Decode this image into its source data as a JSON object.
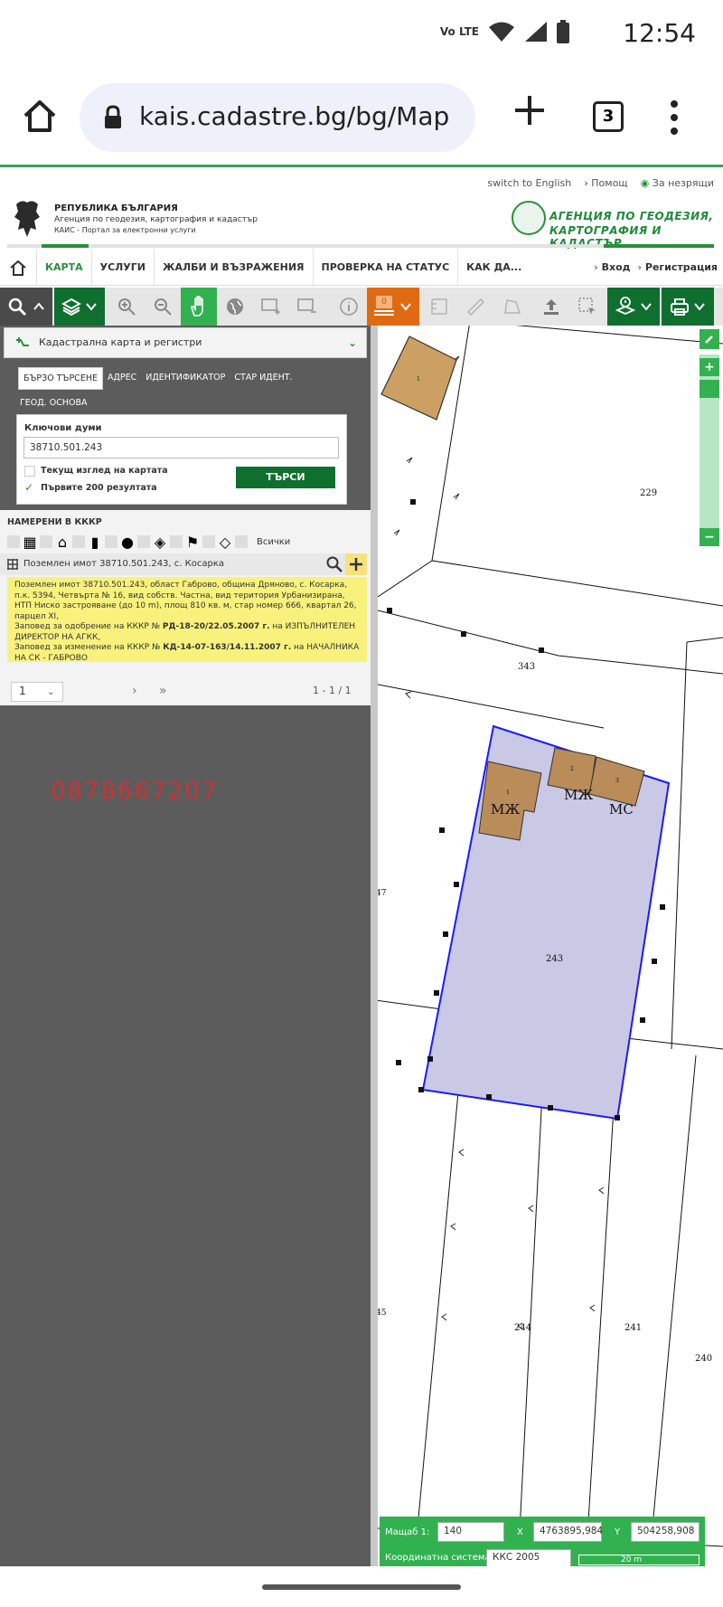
{
  "status_bar": {
    "time": "12:54",
    "network": "Vo LTE"
  },
  "browser": {
    "url": "kais.cadastre.bg/bg/Map",
    "tab_count": "3"
  },
  "header": {
    "top_links": {
      "english": "switch to English",
      "help": "Помощ",
      "accessibility": "За незрящи"
    },
    "republic_title": "РЕПУБЛИКА БЪЛГАРИЯ",
    "republic_sub1": "Агенция по геодезия, картография и кадастър",
    "republic_sub2": "КАИС - Портал за електронни услуги",
    "agency_line1": "АГЕНЦИЯ ПО ГЕОДЕЗИЯ,",
    "agency_line2": "КАРТОГРАФИЯ И КАДАСТЪР"
  },
  "nav": {
    "items": [
      "КАРТА",
      "УСЛУГИ",
      "ЖАЛБИ И ВЪЗРАЖЕНИЯ",
      "ПРОВЕРКА НА СТАТУС",
      "КАК ДА..."
    ],
    "login": "Вход",
    "register": "Регистрация"
  },
  "toolbar": {
    "orange_badge": "0"
  },
  "panel": {
    "layer_label": "Кадастрална карта и регистри",
    "tabs": [
      "БЪРЗО ТЪРСЕНЕ",
      "АДРЕС",
      "ИДЕНТИФИКАТОР",
      "СТАР ИДЕНТ."
    ],
    "tab_geo": "ГЕОД. ОСНОВА",
    "keywords_label": "Ключови думи",
    "keywords_value": "38710.501.243",
    "chk_current_view": "Текущ изглед на картата",
    "chk_first200": "Първите 200 резултата",
    "search_button": "ТЪРСИ",
    "found_title": "НАМЕРЕНИ В КККР",
    "filter_all": "Всички",
    "result_title": "Поземлен имот 38710.501.243, с. Косарка",
    "result_desc": "Поземлен имот 38710.501.243, област Габрово, община Дряново, с. Косарка, п.к. 5394, Четвърта № 16, вид собств. Частна, вид територия Урбанизирана, НТП Ниско застрояване (до 10 m), площ 810 кв. м, стар номер 666, квартал 26, парцел XI,",
    "order1_prefix": "Заповед за одобрение на КККР №",
    "order1_bold": "РД-18-20/22.05.2007 г.",
    "order1_suffix": "на ИЗПЪЛНИТЕЛЕН ДИРЕКТОР НА АГКК,",
    "order2_prefix": "Заповед за изменение на КККР №",
    "order2_bold": "КД-14-07-163/14.11.2007 г.",
    "order2_suffix": "на НАЧАЛНИКА НА СК - ГАБРОВО",
    "page_value": "1",
    "page_count": "1 - 1 / 1",
    "phone": "0878667207"
  },
  "map": {
    "labels": {
      "p229": "229",
      "p343": "343",
      "p243": "243",
      "p244": "244",
      "p241": "241",
      "p240": "240",
      "p47": "47",
      "p45": "45",
      "b1": "1",
      "b1b": "1",
      "b2": "2",
      "b3": "3",
      "mzh1": "МЖ",
      "mzh2": "МЖ",
      "ms": "МС"
    },
    "colors": {
      "selected_fill": "#c9c9e6",
      "selected_stroke": "#1a1aff",
      "building": "#c8a064"
    }
  },
  "scale": {
    "scale_label": "Мащаб 1:",
    "scale_value": "140",
    "x_label": "X",
    "x_value": "4763895,984",
    "y_label": "Y",
    "y_value": "504258,908",
    "crs_label": "Координатна система",
    "crs_value": "ККС 2005",
    "bar_label": "20 m"
  }
}
